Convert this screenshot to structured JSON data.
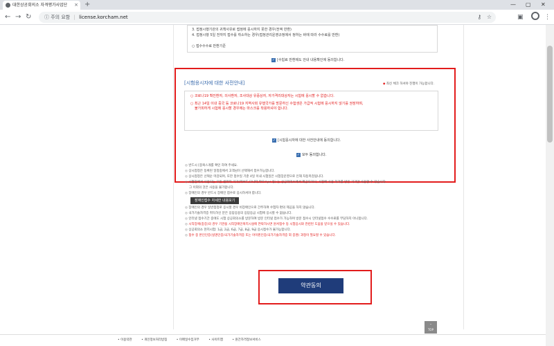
{
  "browser": {
    "tab_title": "대한상공회의소 자격평가사업단",
    "tab_close": "×",
    "new_tab": "+",
    "security_label": "주의 요함",
    "url": "license.korcham.net",
    "window_controls": [
      "—",
      "▢",
      "✕"
    ]
  },
  "terms_box": {
    "lines": [
      "3. 접정시행기관의 귀책사유로 접정에 응시하지 못한 경우(전액 반환)",
      "4. 접정시행 5일 전까지 접수를 취소하는 경우(접정관리운영규정에서 정하는 바에 따라 수수료를 반환)",
      "",
      "○ 접수수수료 반환기준"
    ]
  },
  "agree_refund_label": "[수험료 반환제도 안내 내용확인에 동의합니다.",
  "notice": {
    "title": "[시험응시자에 대한 사전안내]",
    "note": "최신 체크 하셔야 진행이 가능합니다.",
    "paragraph1": "○  코로나19 확진환자, 의사환자, 조사대상 유증상자, 자가격리대상자는 시험에 응시할 수 없습니다.",
    "paragraph2_line1": "○  최근 14일 이내 중국 등 코로나19 지역사회 유행국가를 방문하신 수험생은 가급적 시험에 응시하지 않기를 권장하며,",
    "paragraph2_line2": "불가피하게 시험에 응시할 경우에는 마스크를 착용하셔야 합니다.",
    "agree_label": "[시험응시자에 대한 사전안내에 동의합니다."
  },
  "all_agree_label": "모두 동의합니다.",
  "guide": {
    "items": [
      {
        "text": "반드시 [중복스개를 확인 하여 주세요.",
        "red": false
      },
      {
        "text": "상시접정은 등록된 일정중에서 고객님이 선택해서 접수가능합니다.",
        "red": false
      },
      {
        "text": "상시접정은 선택순 마감되며, 또한 접수일 기준 4일 이내 시험일은 시험장운영으로 인해 차등마감됩니다.",
        "red": false
      },
      {
        "text": "시험장에서 사용되는 모든 컴퓨터 기기(키보드,모니터,마우스pc 등) 는 상공회의소에서 제공되거나, 사전에 사용 허가를 받은 기기만 사용할 수 있습니다.",
        "red": false
      },
      {
        "text": "그 이외의 것은 사용을 불가합니다.",
        "red": false
      },
      {
        "text": "장애인의 경우 반드시 장애인 접수로 응시하셔야 합니다.",
        "red": false
      }
    ],
    "button_label": "장애인접수 자세한 내용보기",
    "items2": [
      {
        "text": "장애인의 경우 일반접정로 응시할 경우 비장애인으로 간주하여 수험자 편의 제공을 하지 않습니다.",
        "red": false
      },
      {
        "text": "국가기술자격증 취득하신 분은 응답응용의 응답응금 시험에 응시할 수 없습니다.",
        "red": false
      },
      {
        "text": "인터넷 접수기간 중에도 시험 상공회의소를 방문하여 방문 인터넷 접수가 가능하며 방문 접수시 인터넷접수 수수료를 부담하지 아니합니다.",
        "red": false
      },
      {
        "text": "시작장애(중증)의 경우 기관을 시작장애인복지시설에 연락하시면 원서접수 등 시험응시와 관련된 도움을 받으실 수 있습니다.",
        "red": true
      },
      {
        "text": "상공회의소 현지시험: 1급, 2급, 6급, 7급, 8급, 9급 응시접수가 불가능합니다.",
        "red": false
      },
      {
        "text": "접수 중 본인인증(실명인증/국가기술자격증 또는 아이핀인증/국가기술자격증 외 증명) 과정이 필요할 수 있습니다.",
        "red": true
      }
    ]
  },
  "submit_label": "약관동의",
  "top_button_label": "TOP",
  "footer": {
    "links": [
      "이용약관",
      "개인정보처리방침",
      "이메일수집거부",
      "사이트맵",
      "원간자격정보서비스"
    ]
  }
}
